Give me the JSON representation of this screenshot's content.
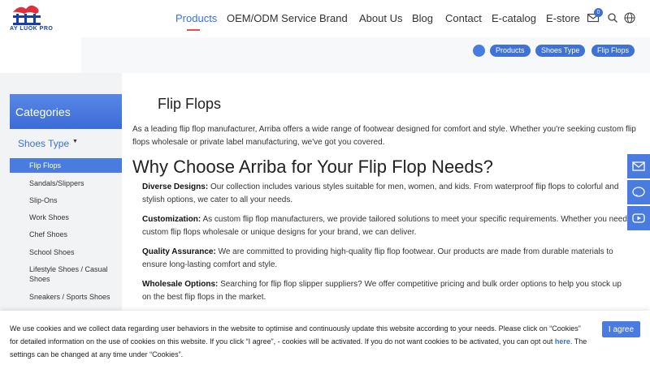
{
  "header": {
    "logo_text": "AY LUOK PRO",
    "nav": [
      {
        "label": "Products"
      },
      {
        "label": "OEM/ODM Service"
      },
      {
        "label": "Brand"
      },
      {
        "label": "About Us"
      },
      {
        "label": "Blog"
      },
      {
        "label": "Contact"
      },
      {
        "label": "E-catalog"
      },
      {
        "label": "E-store"
      }
    ],
    "mail_badge": "0",
    "icons": [
      "mail-icon",
      "search-icon",
      "globe-icon"
    ]
  },
  "breadcrumb": {
    "items": [
      {
        "label": "Products"
      },
      {
        "label": "Shoes Type"
      },
      {
        "label": "Flip Flops"
      }
    ]
  },
  "sidebar": {
    "title": "Categories",
    "group": "Shoes Type",
    "items": [
      {
        "label": "Flip Flops"
      },
      {
        "label": "Sandals/Slippers"
      },
      {
        "label": "Slip-Ons"
      },
      {
        "label": "Work Shoes"
      },
      {
        "label": "Chef Shoes"
      },
      {
        "label": "School Shoes"
      },
      {
        "label": "Lifestyle Shoes / Casual Shoes"
      },
      {
        "label": "Sneakers / Sports Shoes"
      }
    ]
  },
  "main": {
    "title": "Flip Flops",
    "intro": "As a leading flip flop manufacturer, Arriba offers a wide range of footwear designed for comfort and style. Whether you're seeking custom flip flops wholesale or private label manufacturing, we've got you covered.",
    "heading": "Why Choose Arriba for Your Flip Flop Needs?",
    "points": [
      {
        "title": "Diverse Designs:",
        "text": "Our collection includes various styles suitable for men, women, and kids. From waterproof flip flops to colorful and stylish options, we cater to all your needs."
      },
      {
        "title": "Customization:",
        "text": "As custom flip flop manufacturers, we provide tailored solutions to meet your specific requirements. Whether you need custom flip flops wholesale or unique designs for your brand, we can deliver."
      },
      {
        "title": "Quality Assurance:",
        "text": "We are committed to providing high-quality flip flop footwear. Our products are made from durable materials to ensure long-lasting comfort and style."
      },
      {
        "title": "Wholesale Options:",
        "text": "Searching for flip flop slipper suppliers? We offer competitive pricing and bulk order options to help you stock up on the best flip flops in the market."
      }
    ]
  },
  "side_buttons": [
    "mail-icon",
    "line-icon",
    "youtube-icon"
  ],
  "cookie": {
    "text_before": "We use cookies and we collect data regarding user behaviors in the website to optimise and continuously update this website  according to your needs. Please click on “Cookies” for detailed information on the use of cookies on this website. If you click “I agree”, - cookies will be activated. If you do not want cookies to be activated, you can opt out",
    "link": "here",
    "text_after": ". The settings can be changed at any time under “Cookies”.",
    "agree_label": "I agree"
  },
  "colors": {
    "accent": "#4a7be0",
    "nav_active": "#3a6fd8",
    "underline": "#e05050"
  }
}
